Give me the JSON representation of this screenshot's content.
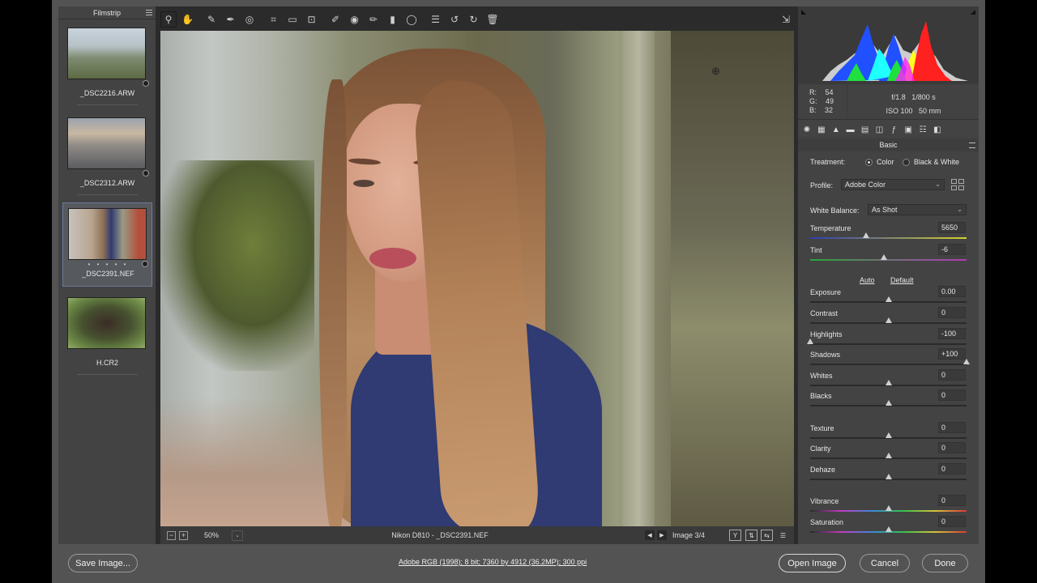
{
  "filmstrip": {
    "title": "Filmstrip",
    "items": [
      {
        "name": "_DSC2216.ARW"
      },
      {
        "name": "_DSC2312.ARW"
      },
      {
        "name": "_DSC2391.NEF",
        "stars": "• • • • •"
      },
      {
        "name": "H.CR2"
      }
    ]
  },
  "toolbar": {
    "tools": [
      "zoom-icon",
      "hand-icon",
      "white-balance-icon",
      "color-sampler-icon",
      "targeted-adjustment-icon",
      "crop-icon",
      "straighten-icon",
      "transform-icon",
      "spot-removal-icon",
      "red-eye-icon",
      "adjustment-brush-icon",
      "graduated-filter-icon",
      "radial-filter-icon",
      "preferences-icon",
      "rotate-left-icon",
      "rotate-right-icon",
      "trash-icon"
    ],
    "export_icon": "export-icon"
  },
  "photobar": {
    "zoom": "50%",
    "file_info": "Nikon D810  -  _DSC2391.NEF",
    "image_count": "Image 3/4",
    "view_buttons": [
      "Y",
      "⇅",
      "⇆",
      "☰"
    ]
  },
  "histogram": {
    "colors": {
      "red": "#ff2020",
      "green": "#20e040",
      "blue": "#2050ff",
      "yellow": "#ffff20",
      "cyan": "#20ffff",
      "magenta": "#ff20ff"
    }
  },
  "readout": {
    "r_label": "R:",
    "r": "54",
    "g_label": "G:",
    "g": "49",
    "b_label": "B:",
    "b": "32",
    "aperture": "f/1.8",
    "shutter": "1/800 s",
    "iso": "ISO 100",
    "focal": "50 mm"
  },
  "panel": {
    "section": "Basic",
    "treatment_label": "Treatment:",
    "treatment_color": "Color",
    "treatment_bw": "Black & White",
    "profile_label": "Profile:",
    "profile_value": "Adobe Color",
    "wb_label": "White Balance:",
    "wb_value": "As Shot",
    "auto": "Auto",
    "default": "Default",
    "sliders": [
      {
        "label": "Temperature",
        "value": "5650",
        "pos": 0.36
      },
      {
        "label": "Tint",
        "value": "-6",
        "pos": 0.47
      },
      {
        "label": "Exposure",
        "value": "0.00",
        "pos": 0.5
      },
      {
        "label": "Contrast",
        "value": "0",
        "pos": 0.5
      },
      {
        "label": "Highlights",
        "value": "-100",
        "pos": 0.0
      },
      {
        "label": "Shadows",
        "value": "+100",
        "pos": 1.0
      },
      {
        "label": "Whites",
        "value": "0",
        "pos": 0.5
      },
      {
        "label": "Blacks",
        "value": "0",
        "pos": 0.5
      },
      {
        "label": "Texture",
        "value": "0",
        "pos": 0.5
      },
      {
        "label": "Clarity",
        "value": "0",
        "pos": 0.5
      },
      {
        "label": "Dehaze",
        "value": "0",
        "pos": 0.5
      },
      {
        "label": "Vibrance",
        "value": "0",
        "pos": 0.5
      },
      {
        "label": "Saturation",
        "value": "0",
        "pos": 0.5
      }
    ]
  },
  "footer": {
    "save": "Save Image...",
    "workflow": "Adobe RGB (1998); 8 bit; 7360 by 4912 (36.2MP); 300 ppi",
    "open": "Open Image",
    "cancel": "Cancel",
    "done": "Done"
  }
}
